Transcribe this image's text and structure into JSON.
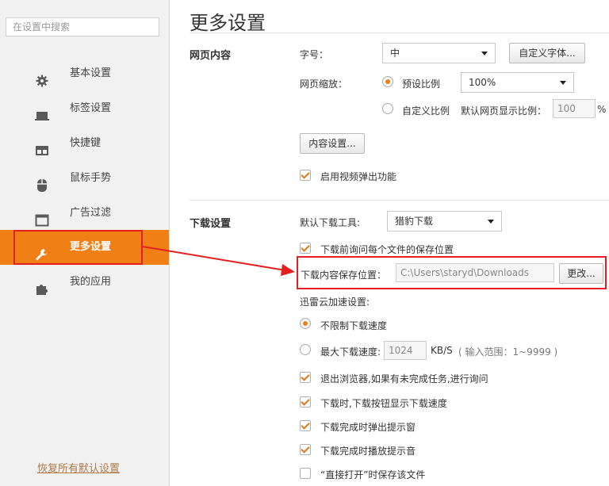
{
  "sidebar": {
    "search_placeholder": "在设置中搜索",
    "items": [
      {
        "label": "基本设置",
        "icon": "gear-icon"
      },
      {
        "label": "标签设置",
        "icon": "tab-icon"
      },
      {
        "label": "快捷键",
        "icon": "keyboard-icon"
      },
      {
        "label": "鼠标手势",
        "icon": "mouse-icon"
      },
      {
        "label": "广告过滤",
        "icon": "window-icon"
      },
      {
        "label": "更多设置",
        "icon": "wrench-icon"
      },
      {
        "label": "我的应用",
        "icon": "puzzle-icon"
      }
    ],
    "active_index": 5,
    "restore_label": "恢复所有默认设置"
  },
  "main": {
    "title": "更多设置",
    "web_content": {
      "heading": "网页内容",
      "font_size_label": "字号：",
      "font_size_value": "中",
      "custom_font_button": "自定义字体...",
      "zoom_label": "网页缩放：",
      "preset_ratio_label": "预设比例",
      "preset_ratio_value": "100%",
      "custom_ratio_label": "自定义比例",
      "default_ratio_label": "默认网页显示比例：",
      "default_ratio_value": "100",
      "percent_sign": "%",
      "content_settings_button": "内容设置...",
      "video_popup_label": "启用视频弹出功能"
    },
    "download": {
      "heading": "下载设置",
      "default_tool_label": "默认下载工具:",
      "default_tool_value": "猎豹下载",
      "ask_location_label": "下载前询问每个文件的保存位置",
      "save_location_label": "下载内容保存位置：",
      "save_location_value": "C:\\Users\\staryd\\Downloads",
      "change_button": "更改...",
      "thunder_label": "迅雷云加速设置:",
      "unlimited_label": "不限制下载速度",
      "max_speed_label": "最大下载速度:",
      "max_speed_value": "1024",
      "speed_unit": "KB/S",
      "speed_range": "( 输入范围：1~9999 )",
      "exit_ask_label": "退出浏览器,如果有未完成任务,进行询问",
      "show_speed_label": "下载时,下载按钮显示下载速度",
      "done_popup_label": "下载完成时弹出提示窗",
      "done_sound_label": "下载完成时播放提示音",
      "direct_open_label": "“直接打开”时保存该文件"
    }
  },
  "colors": {
    "accent": "#f07f16",
    "highlight": "#e41f1f"
  }
}
